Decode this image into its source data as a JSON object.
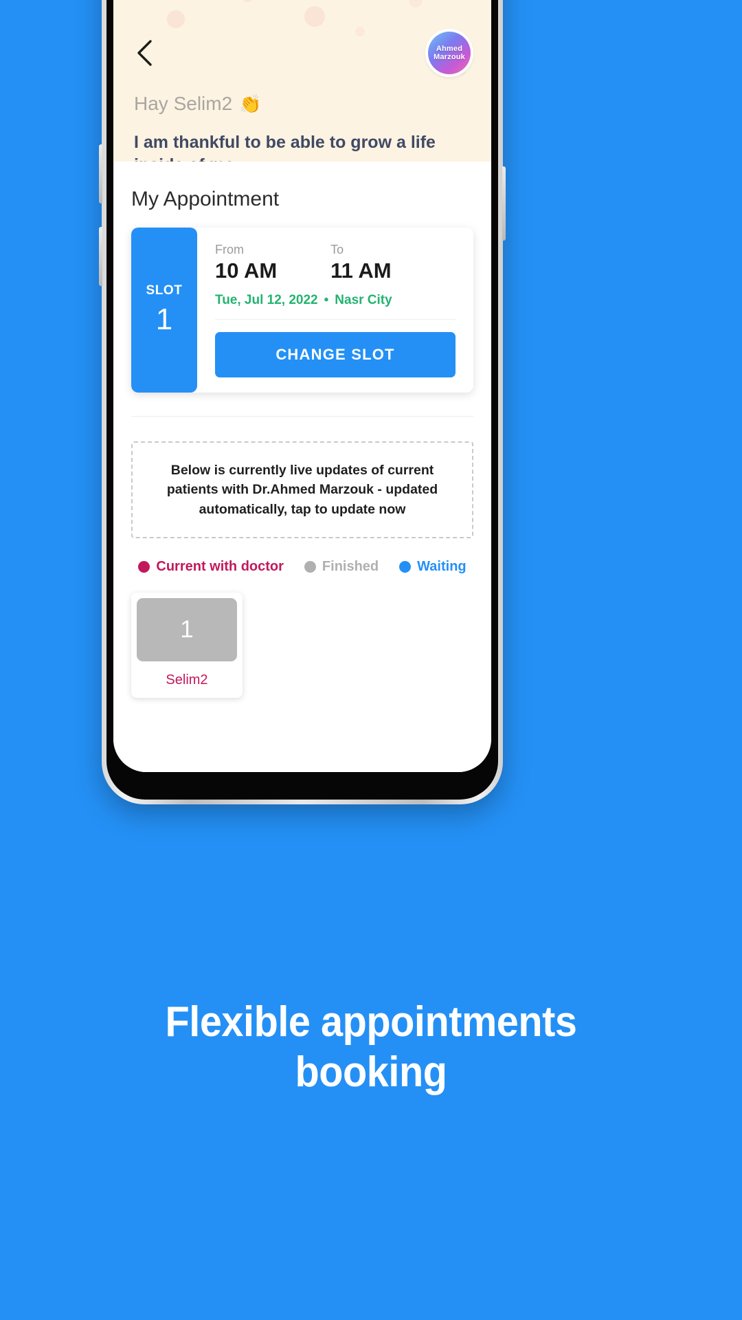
{
  "colors": {
    "background_blue": "#2490f5",
    "header_cream": "#fdf3e2",
    "accent_blue": "#2490f5",
    "green_meta": "#24b371",
    "crimson": "#c2185b",
    "gray": "#b0b0b0"
  },
  "header": {
    "back_icon": "chevron-left-icon",
    "avatar": {
      "name": "Ahmed Marzouk",
      "line1": "Ahmed",
      "line2": "Marzouk"
    },
    "greeting": "Hay Selim2",
    "greeting_emoji": "👏",
    "affirmation": "I am thankful to be able to grow a life inside of me."
  },
  "appointment": {
    "section_title": "My Appointment",
    "slot_label": "SLOT",
    "slot_number": "1",
    "from_label": "From",
    "from_value": "10 AM",
    "to_label": "To",
    "to_value": "11 AM",
    "date": "Tue, Jul 12, 2022",
    "separator": "•",
    "location": "Nasr City",
    "change_slot_label": "CHANGE SLOT"
  },
  "live": {
    "info_text": "Below is currently live updates of current patients with Dr.Ahmed Marzouk - updated automatically, tap to update now",
    "legend": [
      {
        "label": "Current with doctor",
        "color": "#c2185b"
      },
      {
        "label": "Finished",
        "color": "#b0b0b0"
      },
      {
        "label": "Waiting",
        "color": "#2490f5"
      }
    ],
    "queue": [
      {
        "number": "1",
        "name": "Selim2",
        "tile_color": "#b8b8b8",
        "name_color": "#c2185b"
      }
    ]
  },
  "caption": {
    "line1": "Flexible appointments",
    "line2": "booking"
  }
}
